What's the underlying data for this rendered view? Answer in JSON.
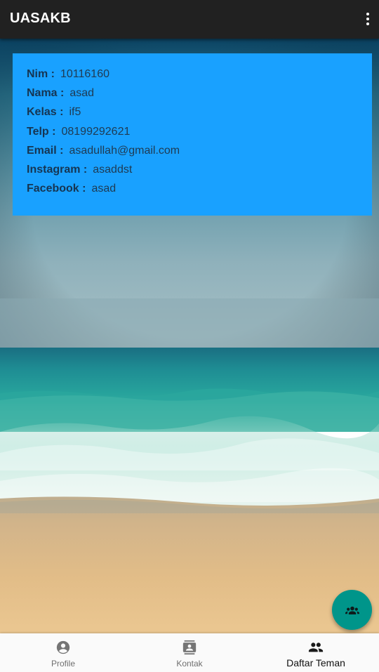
{
  "app": {
    "title": "UASAKB",
    "overflow_icon": "more-vert-icon"
  },
  "profile": [
    {
      "label": "Nim :",
      "value": "10116160"
    },
    {
      "label": "Nama :",
      "value": "asad"
    },
    {
      "label": "Kelas :",
      "value": "if5"
    },
    {
      "label": "Telp :",
      "value": "08199292621"
    },
    {
      "label": "Email :",
      "value": "asadullah@gmail.com"
    },
    {
      "label": "Instagram :",
      "value": "asaddst"
    },
    {
      "label": "Facebook :",
      "value": "asad"
    }
  ],
  "fab": {
    "icon": "group-icon"
  },
  "nav": [
    {
      "label": "Profile",
      "icon": "account-circle-icon",
      "active": false
    },
    {
      "label": "Kontak",
      "icon": "contacts-icon",
      "active": false
    },
    {
      "label": "Daftar Teman",
      "icon": "people-icon",
      "active": true
    }
  ],
  "colors": {
    "appbar": "#212121",
    "card": "#19a1ff",
    "fab": "#00958a",
    "nav_bg": "#fafafa",
    "nav_active": "#111111",
    "nav_inactive": "#6f6f6f"
  }
}
